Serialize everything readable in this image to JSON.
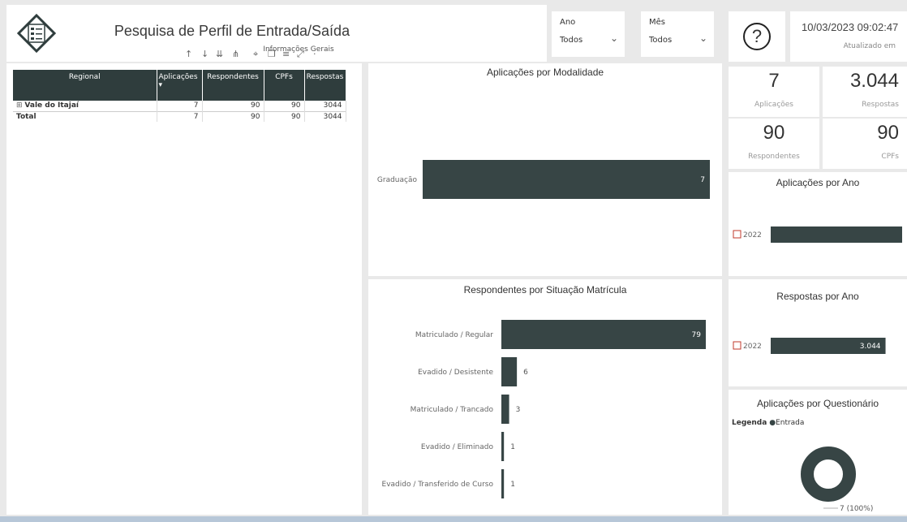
{
  "header": {
    "title": "Pesquisa de Perfil de Entrada/Saída",
    "subtitle": "Informações Gerais"
  },
  "slicers": {
    "ano": {
      "label": "Ano",
      "value": "Todos"
    },
    "mes": {
      "label": "Mês",
      "value": "Todos"
    }
  },
  "datetime": {
    "value": "10/03/2023 09:02:47",
    "label": "Atualizado em"
  },
  "help": {
    "label": "?"
  },
  "table": {
    "headers": [
      "Regional",
      "Aplicações",
      "Respondentes",
      "CPFs",
      "Respostas"
    ],
    "rows": [
      {
        "regional": "Vale do Itajaí",
        "aplicacoes": "7",
        "respondentes": "90",
        "cpfs": "90",
        "respostas": "3044"
      },
      {
        "regional": "Total",
        "aplicacoes": "7",
        "respondentes": "90",
        "cpfs": "90",
        "respostas": "3044"
      }
    ]
  },
  "kpis": {
    "aplicacoes": {
      "value": "7",
      "label": "Aplicações"
    },
    "respostas": {
      "value": "3.044",
      "label": "Respostas"
    },
    "respondentes": {
      "value": "90",
      "label": "Respondentes"
    },
    "cpfs": {
      "value": "90",
      "label": "CPFs"
    }
  },
  "legend": {
    "title": "Legenda",
    "item": "Entrada"
  },
  "colors": {
    "bar": "#374545",
    "header": "#2f3d3d"
  },
  "chart_data": [
    {
      "id": "modalidade",
      "type": "bar",
      "title": "Aplicações por Modalidade",
      "categories": [
        "Graduação"
      ],
      "values": [
        7
      ],
      "labels": [
        "7"
      ],
      "xlim": [
        0,
        7
      ]
    },
    {
      "id": "situacao",
      "type": "bar",
      "title": "Respondentes por Situação Matrícula",
      "categories": [
        "Matriculado / Regular",
        "Evadido / Desistente",
        "Matriculado / Trancado",
        "Evadido / Eliminado",
        "Evadido / Transferido de Curso"
      ],
      "values": [
        79,
        6,
        3,
        1,
        1
      ],
      "labels": [
        "79",
        "6",
        "3",
        "1",
        "1"
      ],
      "xlim": [
        0,
        79
      ]
    },
    {
      "id": "aplic_ano",
      "type": "bar",
      "title": "Aplicações por Ano",
      "categories": [
        "2022"
      ],
      "values": [
        7
      ],
      "labels": [
        ""
      ],
      "xlim": [
        0,
        7
      ]
    },
    {
      "id": "resp_ano",
      "type": "bar",
      "title": "Respostas por Ano",
      "categories": [
        "2022"
      ],
      "values": [
        3044
      ],
      "labels": [
        "3.044"
      ],
      "xlim": [
        0,
        4000
      ]
    },
    {
      "id": "questionario",
      "type": "pie",
      "title": "Aplicações por Questionário",
      "categories": [
        "Entrada"
      ],
      "values": [
        7
      ],
      "labels": [
        "7 (100%)"
      ]
    }
  ]
}
